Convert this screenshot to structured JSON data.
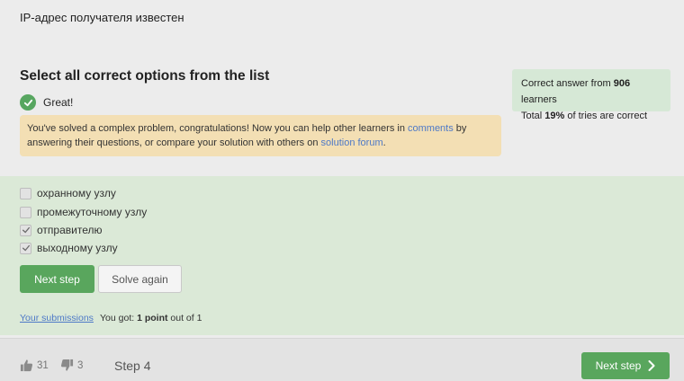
{
  "question": {
    "text": "IP-адрес получателя известен",
    "heading": "Select all correct options from the list"
  },
  "stats": {
    "line1_prefix": "Correct answer from ",
    "learners_count": "906",
    "line1_suffix": " learners",
    "line2_prefix": "Total ",
    "percent": "19%",
    "line2_suffix": " of tries are correct"
  },
  "result": {
    "great_label": "Great!",
    "notice_part1": "You've solved a complex problem, congratulations! Now you can help other learners in ",
    "comments_link": "comments",
    "notice_part2": " by answering their questions, or compare your solution with others on ",
    "forum_link": "solution forum",
    "notice_part3": "."
  },
  "options": [
    {
      "label": "охранному узлу",
      "checked": false
    },
    {
      "label": "промежуточному узлу",
      "checked": false
    },
    {
      "label": "отправителю",
      "checked": true
    },
    {
      "label": "выходному узлу",
      "checked": true
    }
  ],
  "buttons": {
    "next_step": "Next step",
    "solve_again": "Solve again"
  },
  "submissions": {
    "link": "Your submissions",
    "got_prefix": "You got: ",
    "points": "1 point",
    "got_suffix": " out of 1"
  },
  "footer": {
    "likes": "31",
    "dislikes": "3",
    "step": "Step 4",
    "next_label": "Next step"
  },
  "colors": {
    "accent_green": "#59a65d",
    "answer_bg": "#dbe9d7",
    "notice_bg": "#f3dfb4",
    "link_blue": "#4e79c7"
  }
}
